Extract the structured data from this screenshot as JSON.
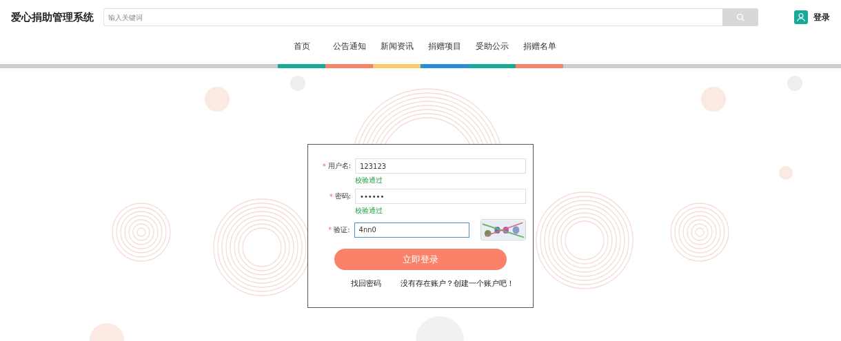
{
  "header": {
    "title": "爱心捐助管理系统",
    "search": {
      "placeholder": "输入关键词"
    },
    "login": "登录"
  },
  "nav": [
    {
      "label": "首页",
      "color": "#17a999"
    },
    {
      "label": "公告通知",
      "color": "#f98268"
    },
    {
      "label": "新闻资讯",
      "color": "#fcc96a"
    },
    {
      "label": "捐赠项目",
      "color": "#2a8fdb"
    },
    {
      "label": "受助公示",
      "color": "#17a999"
    },
    {
      "label": "捐赠名单",
      "color": "#f98268"
    }
  ],
  "form": {
    "fields": [
      {
        "kind": "text",
        "label": "用户名:",
        "marker": "*",
        "value": "123123",
        "hint": "校验通过",
        "focused": false
      },
      {
        "kind": "password",
        "label": "密码:",
        "marker": "*",
        "value": "••••••",
        "hint": "校验通过",
        "focused": false
      },
      {
        "kind": "captcha",
        "label": "验证:",
        "marker": "*",
        "value": "4nn0",
        "focused": true
      }
    ],
    "submit": "立即登录",
    "links": [
      "找回密码",
      "没有存在账户？创建一个账户吧！"
    ]
  }
}
